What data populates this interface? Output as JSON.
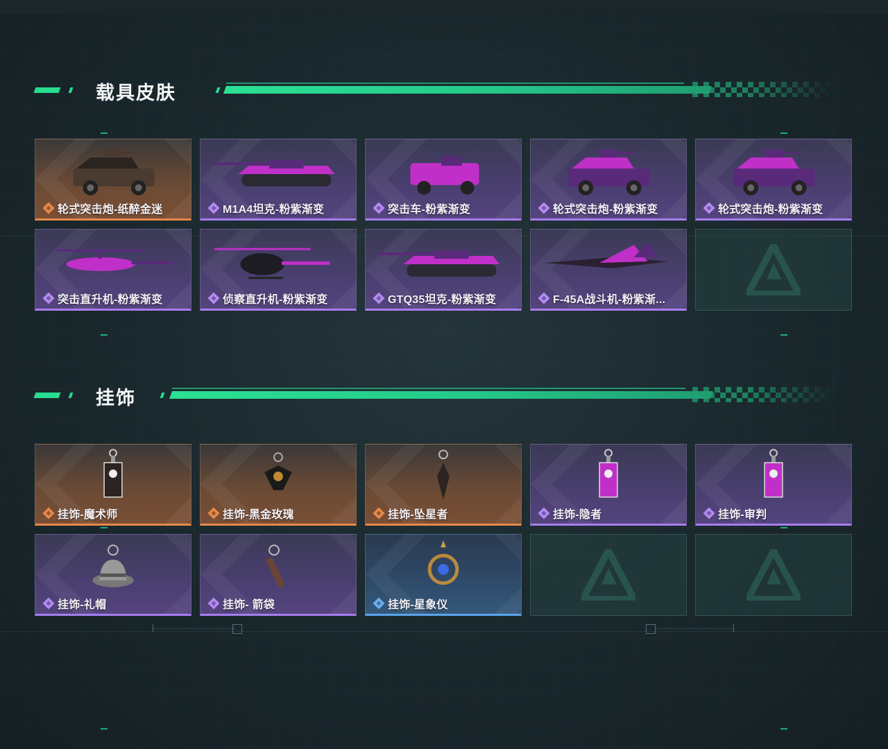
{
  "sections": [
    {
      "title": "载具皮肤",
      "items": [
        {
          "label": "轮式突击炮-纸醉金迷",
          "rarity": "orange",
          "icon": "wheeled-assault-gun-icon"
        },
        {
          "label": "M1A4坦克-粉紫渐变",
          "rarity": "purple",
          "icon": "tank-icon"
        },
        {
          "label": "突击车-粉紫渐变",
          "rarity": "purple",
          "icon": "assault-vehicle-icon"
        },
        {
          "label": "轮式突击炮-粉紫渐变",
          "rarity": "purple",
          "icon": "wheeled-assault-gun-icon"
        },
        {
          "label": "轮式突击炮-粉紫渐变",
          "rarity": "purple",
          "icon": "wheeled-assault-gun-icon"
        },
        {
          "label": "突击直升机-粉紫渐变",
          "rarity": "purple",
          "icon": "attack-helicopter-icon"
        },
        {
          "label": "侦察直升机-粉紫渐变",
          "rarity": "purple",
          "icon": "scout-helicopter-icon"
        },
        {
          "label": "GTQ35坦克-粉紫渐变",
          "rarity": "purple",
          "icon": "tank-icon"
        },
        {
          "label": "F-45A战斗机-粉紫渐...",
          "rarity": "purple",
          "icon": "fighter-jet-icon"
        },
        {
          "label": "",
          "rarity": "empty",
          "icon": "empty-slot-logo-icon"
        }
      ]
    },
    {
      "title": "挂饰",
      "items": [
        {
          "label": "挂饰-魔术师",
          "rarity": "orange",
          "icon": "tarot-card-charm-icon"
        },
        {
          "label": "挂饰-黑金玫瑰",
          "rarity": "orange",
          "icon": "rose-charm-icon"
        },
        {
          "label": "挂饰-坠星者",
          "rarity": "orange",
          "icon": "crystal-charm-icon"
        },
        {
          "label": "挂饰-隐者",
          "rarity": "purple",
          "icon": "tarot-card-charm-icon"
        },
        {
          "label": "挂饰-审判",
          "rarity": "purple",
          "icon": "tarot-card-charm-icon"
        },
        {
          "label": "挂饰-礼帽",
          "rarity": "purple",
          "icon": "top-hat-charm-icon"
        },
        {
          "label": "挂饰- 箭袋",
          "rarity": "purple",
          "icon": "quiver-charm-icon"
        },
        {
          "label": "挂饰-星象仪",
          "rarity": "blue",
          "icon": "astrolabe-charm-icon"
        },
        {
          "label": "",
          "rarity": "empty",
          "icon": "empty-slot-logo-icon"
        },
        {
          "label": "",
          "rarity": "empty",
          "icon": "empty-slot-logo-icon"
        }
      ]
    }
  ],
  "colors": {
    "accent": "#28dd90",
    "orange": "#e8894a",
    "purple": "#a77ef0",
    "blue": "#5aa6ec"
  }
}
